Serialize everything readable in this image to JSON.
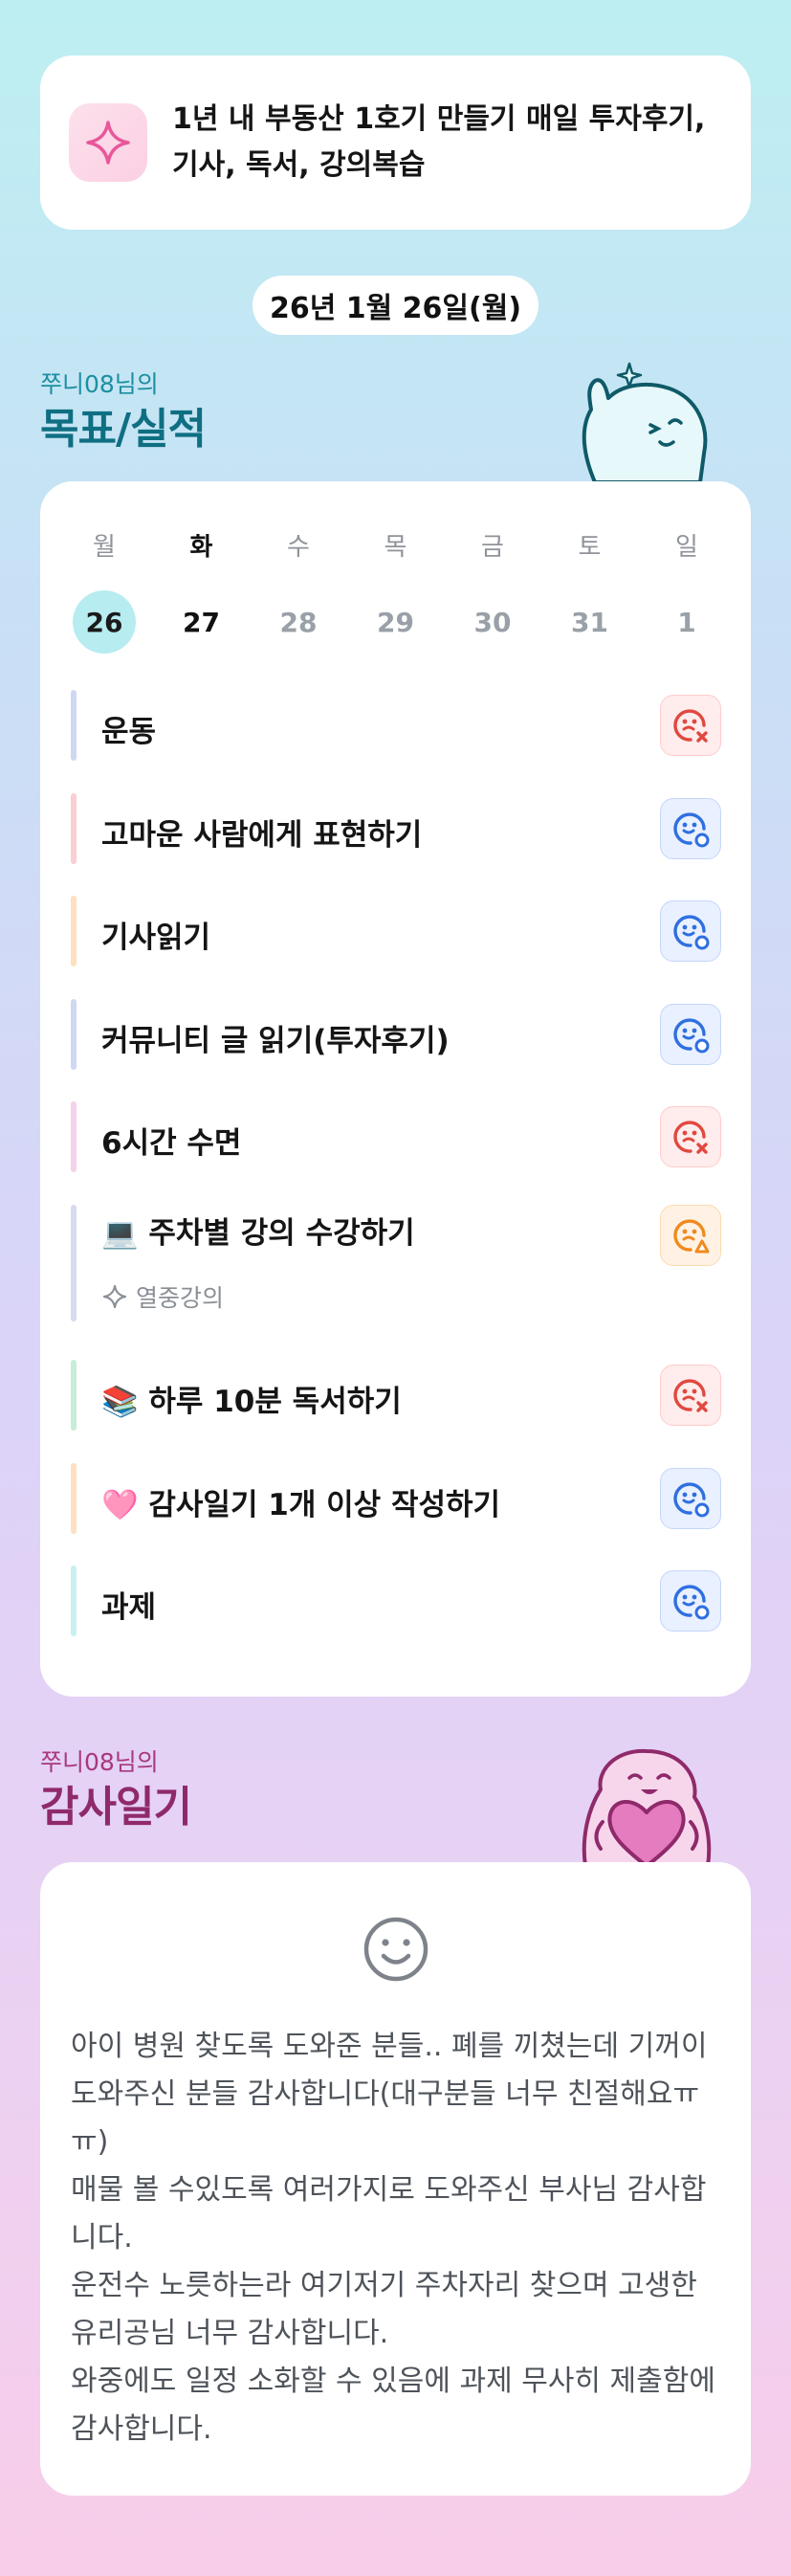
{
  "motto": {
    "icon": "sparkle-icon",
    "text": "1년 내 부동산 1호기 만들기 매일 투자후기, 기사, 독서, 강의복습"
  },
  "date_label": "26년 1월 26일(월)",
  "goals_section": {
    "subtitle": "쭈니08님의",
    "title": "목표/실적"
  },
  "week": {
    "days": [
      {
        "label": "월",
        "date": "26",
        "state": "selected"
      },
      {
        "label": "화",
        "date": "27",
        "state": "next"
      },
      {
        "label": "수",
        "date": "28",
        "state": "future"
      },
      {
        "label": "목",
        "date": "29",
        "state": "future"
      },
      {
        "label": "금",
        "date": "30",
        "state": "future"
      },
      {
        "label": "토",
        "date": "31",
        "state": "future"
      },
      {
        "label": "일",
        "date": "1",
        "state": "future"
      }
    ]
  },
  "goals": [
    {
      "label": "운동",
      "status": "fail",
      "bar_color": "#cfd8f3"
    },
    {
      "label": "고마운 사람에게 표현하기",
      "status": "done",
      "bar_color": "#f9cfd3"
    },
    {
      "label": "기사읽기",
      "status": "done",
      "bar_color": "#fde0bf"
    },
    {
      "label": "커뮤니티 글 읽기(투자후기)",
      "status": "done",
      "bar_color": "#cfd8f3"
    },
    {
      "label": "6시간 수면",
      "status": "fail",
      "bar_color": "#f6d1ea"
    },
    {
      "label": "💻 주차별 강의 수강하기",
      "status": "partial",
      "bar_color": "#d6dbf0",
      "tag": "열중강의"
    },
    {
      "label": "📚 하루 10분 독서하기",
      "status": "fail",
      "bar_color": "#c8eed8"
    },
    {
      "label": "🩷 감사일기 1개 이상 작성하기",
      "status": "done",
      "bar_color": "#fde0bf"
    },
    {
      "label": "과제",
      "status": "done",
      "bar_color": "#c9eff0"
    }
  ],
  "gratitude_section": {
    "subtitle": "쭈니08님의",
    "title": "감사일기",
    "face_icon": "smile-icon",
    "text": "아이 병원 찾도록 도와준 분들.. 폐를 끼쳤는데 기꺼이 도와주신 분들 감사합니다(대구분들 너무 친절해요ㅠㅠ)\n매물 볼 수있도록 여러가지로 도와주신 부사님 감사합니다.\n운전수 노릇하는라 여기저기 주차자리 찾으며 고생한 유리공님 너무 감사합니다.\n와중에도 일정 소화할 수 있음에 과제 무사히 제출함에 감사합니다."
  },
  "colors": {
    "done": "#2f6fe0",
    "fail": "#e0483f",
    "partial": "#f08a1e",
    "goals_title": "#0f6f82",
    "gratitude_title": "#8f2a6a"
  }
}
